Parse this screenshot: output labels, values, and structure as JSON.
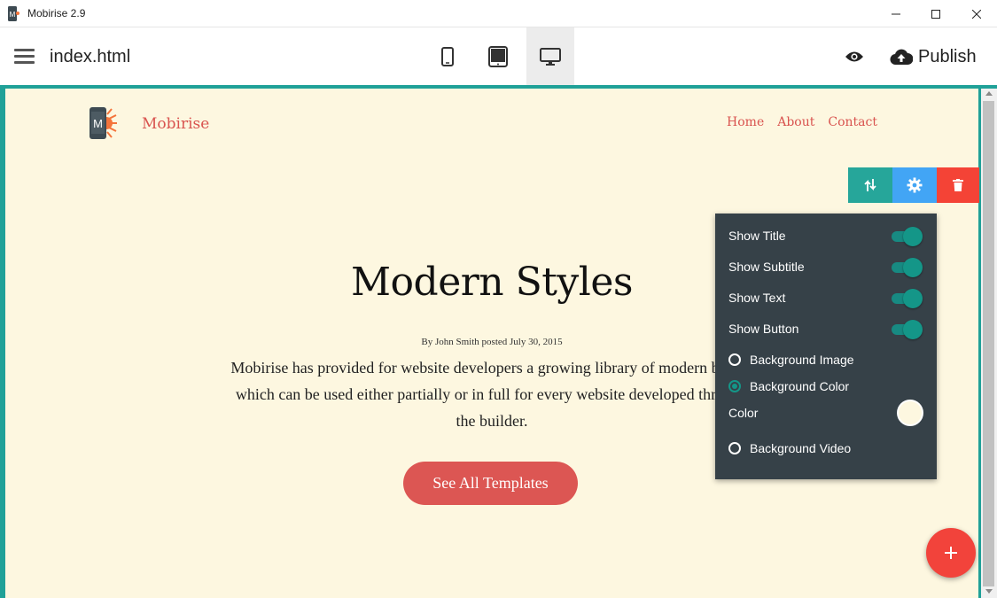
{
  "window": {
    "title": "Mobirise 2.9",
    "controls": [
      "minimize-icon",
      "maximize-icon",
      "close-icon"
    ]
  },
  "toolbar": {
    "menu_icon": "hamburger-icon",
    "filename": "index.html",
    "devices": [
      {
        "name": "mobile",
        "icon": "phone-icon",
        "active": false
      },
      {
        "name": "tablet",
        "icon": "tablet-icon",
        "active": false
      },
      {
        "name": "desktop",
        "icon": "desktop-icon",
        "active": true
      }
    ],
    "preview_icon": "eye-icon",
    "publish_label": "Publish",
    "publish_icon": "cloud-upload-icon"
  },
  "site": {
    "brand": "Mobirise",
    "nav": [
      "Home",
      "About",
      "Contact"
    ],
    "hero_title": "Modern Styles",
    "hero_meta": "By John Smith posted July 30, 2015",
    "hero_text": "Mobirise has provided for website developers a growing library of modern blocks which can be used either partially or in full for every website developed through the builder.",
    "cta_label": "See All Templates",
    "background_color": "#fdf7e0",
    "accent_color": "#dc5653"
  },
  "block_controls": [
    {
      "name": "move",
      "icon": "move-arrows-icon",
      "color": "#26a69a"
    },
    {
      "name": "settings",
      "icon": "gear-icon",
      "color": "#42a5f5"
    },
    {
      "name": "delete",
      "icon": "trash-icon",
      "color": "#f44336"
    }
  ],
  "settings_panel": {
    "toggles": [
      {
        "label": "Show Title",
        "on": true
      },
      {
        "label": "Show Subtitle",
        "on": true
      },
      {
        "label": "Show Text",
        "on": true
      },
      {
        "label": "Show Button",
        "on": true
      }
    ],
    "background_options": {
      "image": {
        "label": "Background Image",
        "selected": false
      },
      "color": {
        "label": "Background Color",
        "selected": true
      },
      "video": {
        "label": "Background Video",
        "selected": false
      }
    },
    "color_label": "Color",
    "color_value": "#fdf7e0"
  },
  "fab_icon": "plus-icon"
}
